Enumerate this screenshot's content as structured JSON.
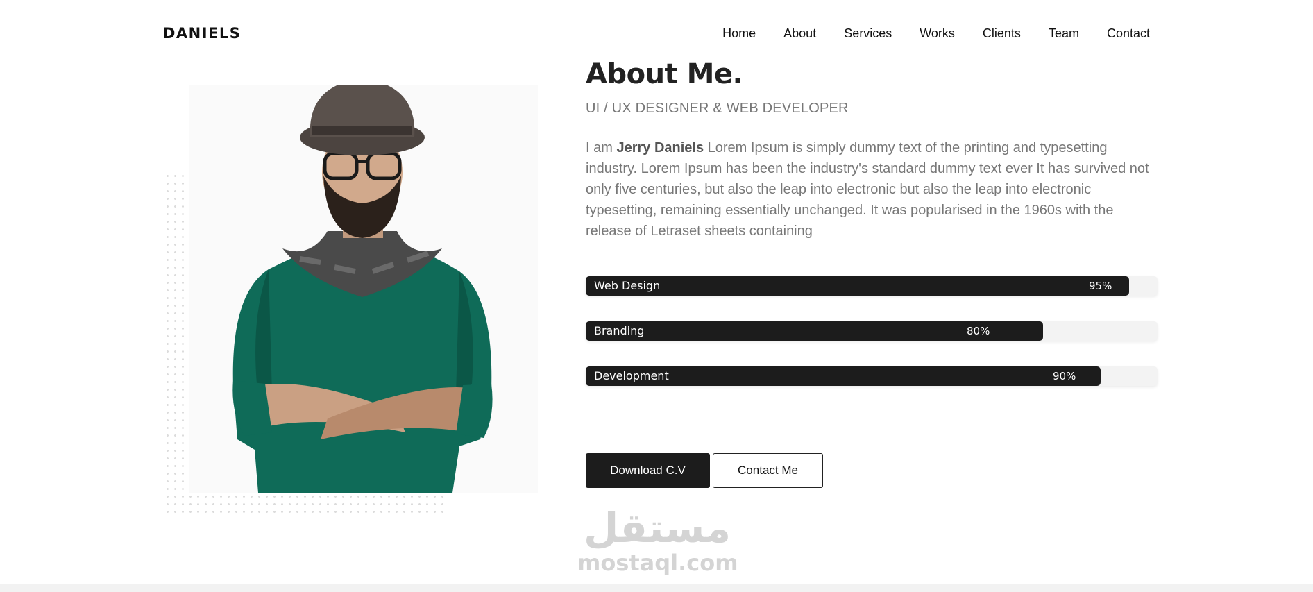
{
  "brand": "DANIELS",
  "nav": [
    "Home",
    "About",
    "Services",
    "Works",
    "Clients",
    "Team",
    "Contact"
  ],
  "about": {
    "heading": "About Me.",
    "subtitle": "UI / UX DESIGNER & WEB DEVELOPER",
    "bio_prefix": "I am ",
    "bio_name": "Jerry Daniels",
    "bio_text": " Lorem Ipsum is simply dummy text of the printing and typesetting industry. Lorem Ipsum has been the industry's standard dummy text ever It has survived not only five centuries, but also the leap into electronic but also the leap into electronic typesetting, remaining essentially unchanged. It was popularised in the 1960s with the release of Letraset sheets containing"
  },
  "skills": [
    {
      "name": "Web Design",
      "percent": 95,
      "label": "95%"
    },
    {
      "name": "Branding",
      "percent": 80,
      "label": "80%"
    },
    {
      "name": "Development",
      "percent": 90,
      "label": "90%"
    }
  ],
  "buttons": {
    "download": "Download C.V",
    "contact": "Contact Me"
  },
  "watermark": {
    "arabic": "مستقل",
    "latin": "mostaql.com"
  },
  "colors": {
    "accent_dark": "#1c1c1c",
    "text_muted": "#777777",
    "sweater": "#0f6b58"
  }
}
